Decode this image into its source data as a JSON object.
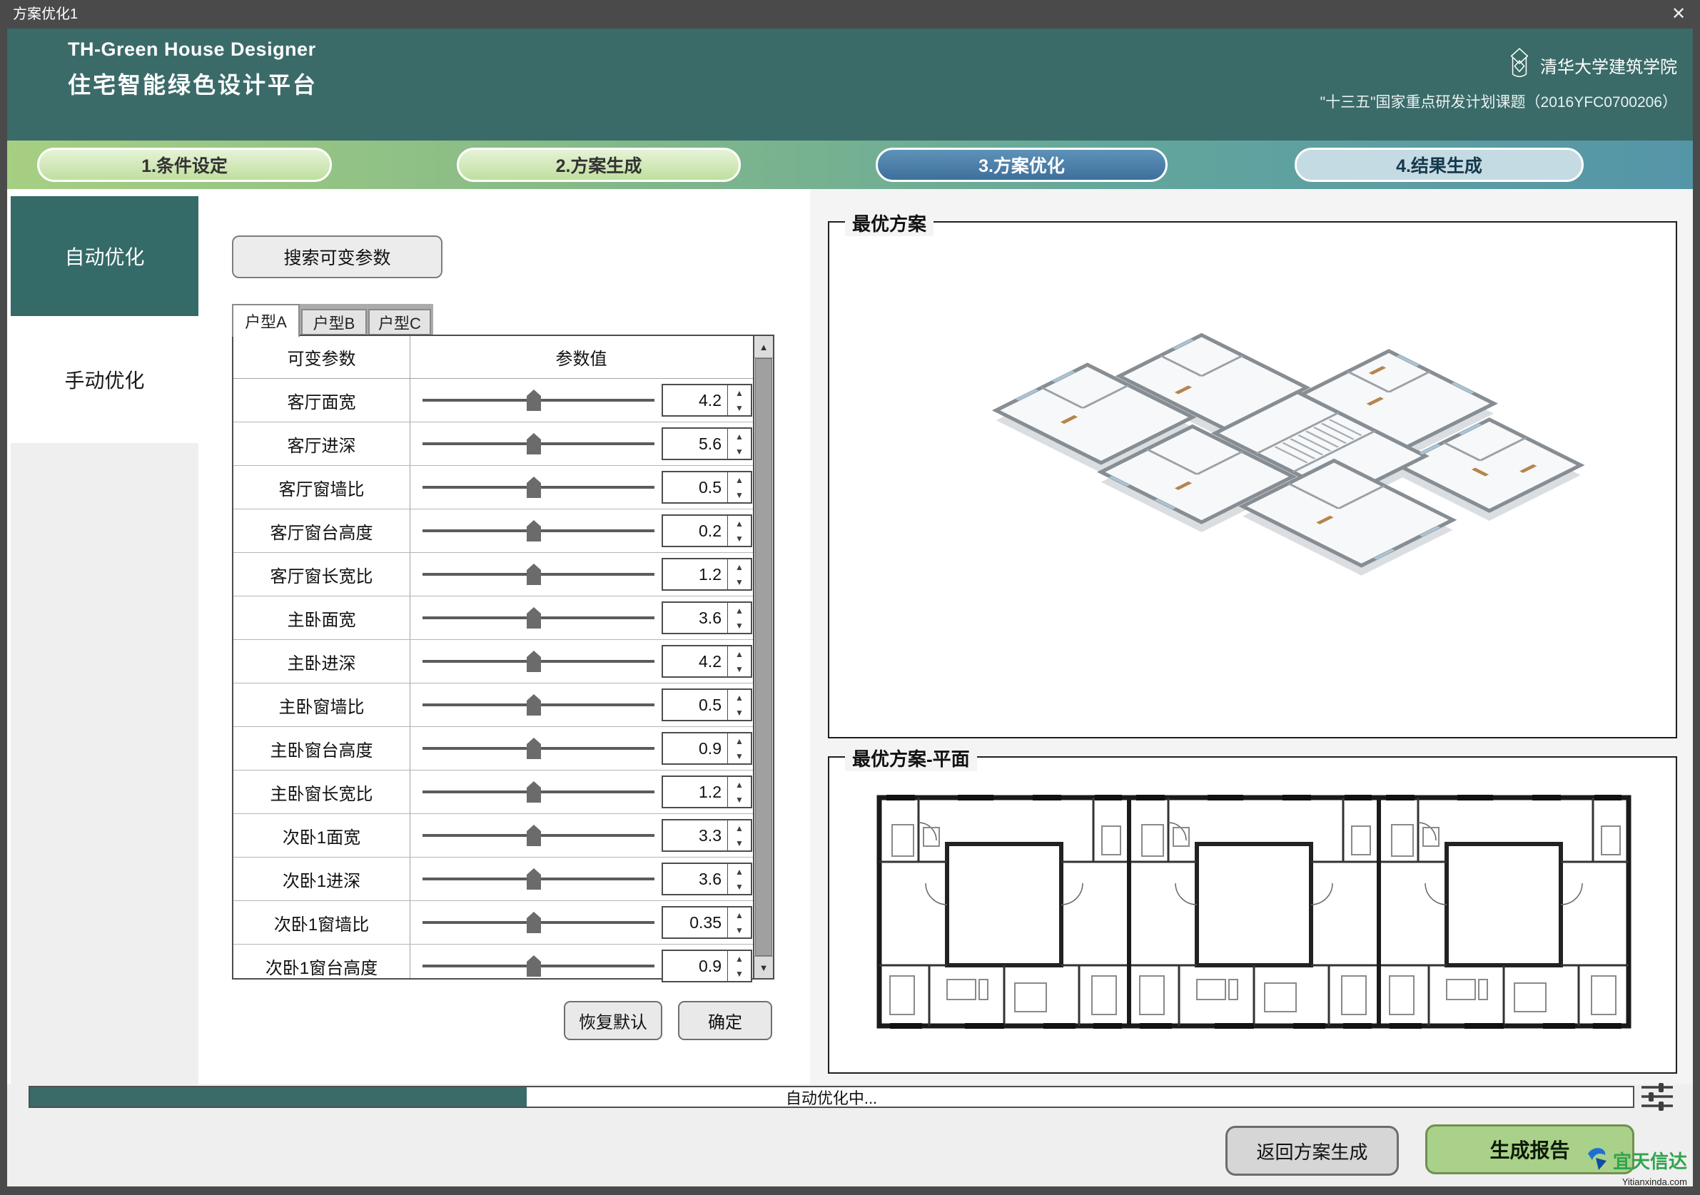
{
  "window": {
    "title": "方案优化1",
    "close_label": "✕"
  },
  "header": {
    "title_en": "TH-Green House Designer",
    "title_zh": "住宅智能绿色设计平台",
    "org": "清华大学建筑学院",
    "project": "\"十三五\"国家重点研发计划课题（2016YFC0700206）"
  },
  "steps": [
    {
      "label": "1.条件设定",
      "state": "done"
    },
    {
      "label": "2.方案生成",
      "state": "done"
    },
    {
      "label": "3.方案优化",
      "state": "active"
    },
    {
      "label": "4.结果生成",
      "state": "todo"
    }
  ],
  "sidebar": {
    "items": [
      {
        "label": "自动优化",
        "active": true
      },
      {
        "label": "手动优化",
        "active": false
      }
    ]
  },
  "panel": {
    "search_button": "搜索可变参数",
    "tabs": [
      "户型A",
      "户型B",
      "户型C"
    ],
    "active_tab": "户型A",
    "table": {
      "col_param": "可变参数",
      "col_value": "参数值",
      "rows": [
        {
          "name": "客厅面宽",
          "value": "4.2",
          "pct": 48
        },
        {
          "name": "客厅进深",
          "value": "5.6",
          "pct": 48
        },
        {
          "name": "客厅窗墙比",
          "value": "0.5",
          "pct": 48
        },
        {
          "name": "客厅窗台高度",
          "value": "0.2",
          "pct": 48
        },
        {
          "name": "客厅窗长宽比",
          "value": "1.2",
          "pct": 48
        },
        {
          "name": "主卧面宽",
          "value": "3.6",
          "pct": 48
        },
        {
          "name": "主卧进深",
          "value": "4.2",
          "pct": 48
        },
        {
          "name": "主卧窗墙比",
          "value": "0.5",
          "pct": 48
        },
        {
          "name": "主卧窗台高度",
          "value": "0.9",
          "pct": 48
        },
        {
          "name": "主卧窗长宽比",
          "value": "1.2",
          "pct": 48
        },
        {
          "name": "次卧1面宽",
          "value": "3.3",
          "pct": 48
        },
        {
          "name": "次卧1进深",
          "value": "3.6",
          "pct": 48
        },
        {
          "name": "次卧1窗墙比",
          "value": "0.35",
          "pct": 48
        },
        {
          "name": "次卧1窗台高度",
          "value": "0.9",
          "pct": 48
        }
      ]
    },
    "reset_button": "恢复默认",
    "confirm_button": "确定"
  },
  "preview": {
    "box1_title": "最优方案",
    "box2_title": "最优方案-平面"
  },
  "footer": {
    "progress_text": "自动优化中...",
    "progress_pct": 31,
    "back_button": "返回方案生成",
    "report_button": "生成报告"
  },
  "watermark": {
    "name": "宜天信达",
    "url": "Yitianxinda.com"
  },
  "icons": {
    "spin_up": "▲",
    "spin_down": "▼",
    "scroll_up": "▲",
    "scroll_down": "▼"
  },
  "colors": {
    "accent_teal": "#3A6B69",
    "active_step_blue": "#4C7FA9",
    "report_green": "#A9D189",
    "progress_fill": "#3A6B68",
    "watermark_green": "#2FA44D",
    "watermark_blue": "#1565C0"
  }
}
